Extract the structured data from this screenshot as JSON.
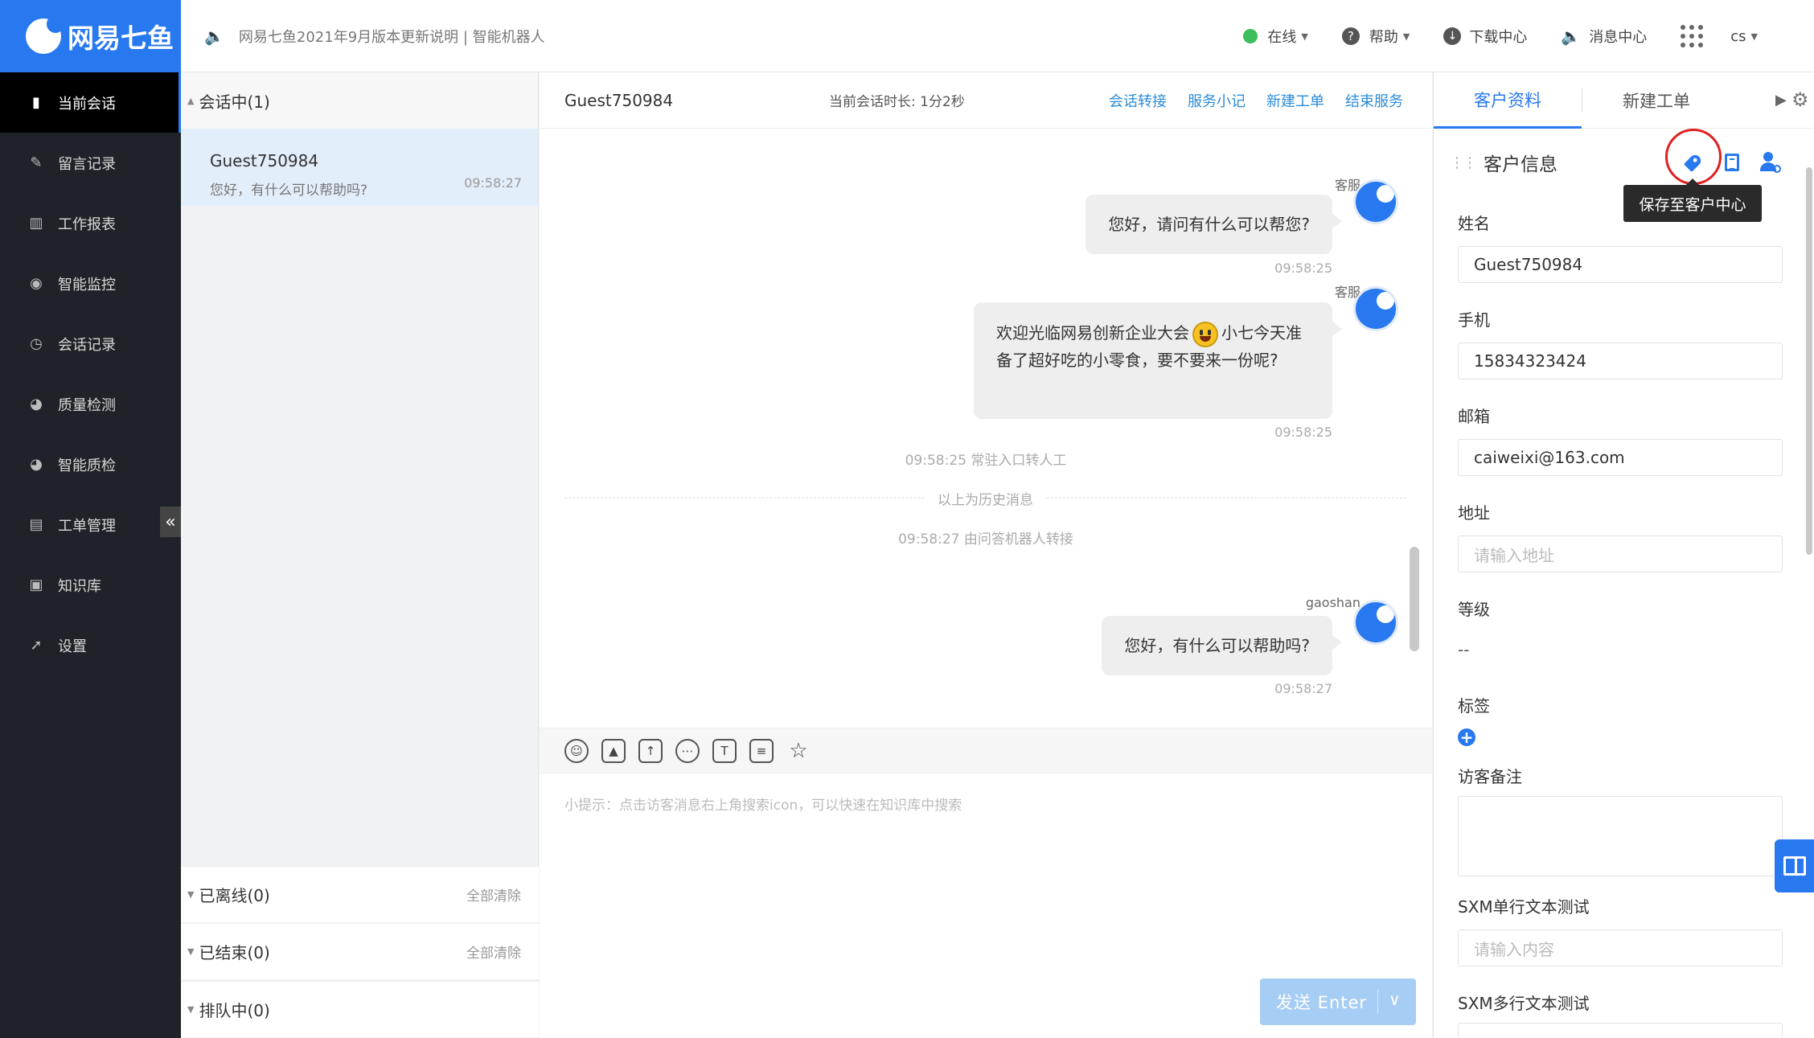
{
  "header": {
    "logo_text": "网易七鱼",
    "notice": "网易七鱼2021年9月版本更新说明 | 智能机器人",
    "status": "在线",
    "help": "帮助",
    "download": "下载中心",
    "messages": "消息中心",
    "user": "cs"
  },
  "nav": {
    "items": [
      {
        "label": "当前会话"
      },
      {
        "label": "留言记录"
      },
      {
        "label": "工作报表"
      },
      {
        "label": "智能监控"
      },
      {
        "label": "会话记录"
      },
      {
        "label": "质量检测"
      },
      {
        "label": "智能质检"
      },
      {
        "label": "工单管理"
      },
      {
        "label": "知识库"
      },
      {
        "label": "设置"
      }
    ]
  },
  "sessions": {
    "active_header": "会话中(1)",
    "item": {
      "name": "Guest750984",
      "last_msg": "您好，有什么可以帮助吗?",
      "time": "09:58:27"
    },
    "offline": "已离线(0)",
    "ended": "已结束(0)",
    "queue": "排队中(0)",
    "clear_all": "全部清除"
  },
  "chat": {
    "guest": "Guest750984",
    "duration": "当前会话时长: 1分2秒",
    "actions": [
      "会话转接",
      "服务小记",
      "新建工单",
      "结束服务"
    ],
    "messages": [
      {
        "sender": "客服",
        "text": "您好，请问有什么可以帮您?",
        "time": "09:58:25"
      },
      {
        "sender": "客服",
        "text_a": "欢迎光临网易创新企业大会",
        "text_b": "小七今天准备了超好吃的小零食，要不要来一份呢?",
        "time": "09:58:25"
      },
      {
        "sender": "gaoshan",
        "text": "您好，有什么可以帮助吗?",
        "time": "09:58:27"
      }
    ],
    "sys_1": "09:58:25 常驻入口转人工",
    "history": "以上为历史消息",
    "sys_2": "09:58:27 由问答机器人转接",
    "hint": "小提示：点击访客消息右上角搜索icon，可以快速在知识库中搜索",
    "send": "发送 Enter"
  },
  "panel": {
    "tab_profile": "客户资料",
    "tab_ticket": "新建工单",
    "section_title": "客户信息",
    "tooltip": "保存至客户中心",
    "fields": {
      "name_label": "姓名",
      "name_value": "Guest750984",
      "phone_label": "手机",
      "phone_value": "15834323424",
      "email_label": "邮箱",
      "email_value": "caiweixi@163.com",
      "address_label": "地址",
      "address_placeholder": "请输入地址",
      "level_label": "等级",
      "level_value": "--",
      "tags_label": "标签",
      "note_label": "访客备注",
      "sxm_single_label": "SXM单行文本测试",
      "sxm_single_placeholder": "请输入内容",
      "sxm_multi_label": "SXM多行文本测试"
    }
  },
  "colors": {
    "brand": "#2878f0",
    "nav_bg": "#1f2329",
    "link": "#2b8bd9",
    "send_disabled": "#a6cdf3",
    "highlight_ring": "#e02020"
  }
}
